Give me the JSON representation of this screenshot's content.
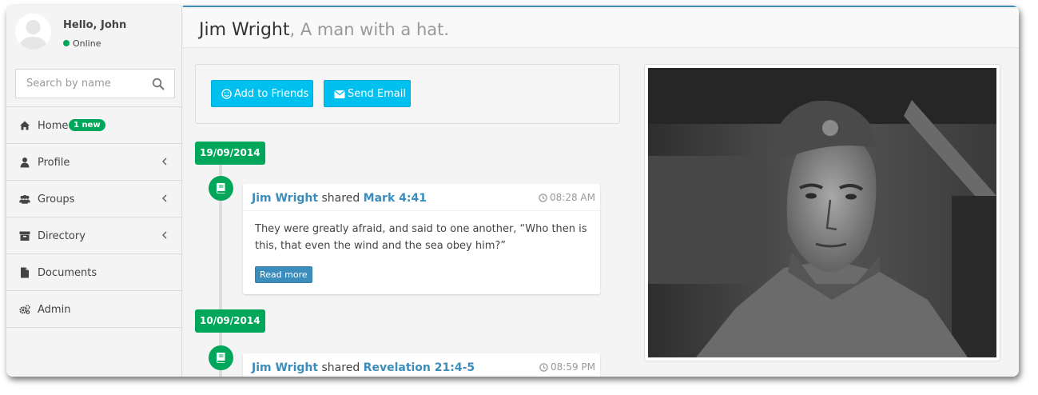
{
  "user": {
    "greeting": "Hello, John",
    "status": "Online",
    "status_color": "#00a65a"
  },
  "search": {
    "placeholder": "Search by name"
  },
  "menu": [
    {
      "label": "Home",
      "icon": "home-icon",
      "badge": "1 new"
    },
    {
      "label": "Profile",
      "icon": "user-icon",
      "has_submenu": true
    },
    {
      "label": "Groups",
      "icon": "users-icon",
      "has_submenu": true
    },
    {
      "label": "Directory",
      "icon": "archive-icon",
      "has_submenu": true
    },
    {
      "label": "Documents",
      "icon": "file-icon"
    },
    {
      "label": "Admin",
      "icon": "cogs-icon"
    }
  ],
  "profile": {
    "name": "Jim Wright",
    "subtitle": ", A man with a hat."
  },
  "actions": {
    "add_friends": "Add to Friends",
    "send_email": "Send Email"
  },
  "timeline": [
    {
      "date": "19/09/2014",
      "author": "Jim Wright",
      "verb": "shared",
      "reference": "Mark 4:41",
      "time": "08:28 AM",
      "body": "They were greatly afraid, and said to one another, “Who then is this, that even the wind and the sea obey him?”",
      "read_more": "Read more"
    },
    {
      "date": "10/09/2014",
      "author": "Jim Wright",
      "verb": "shared",
      "reference": "Revelation 21:4-5",
      "time": "08:59 PM"
    }
  ],
  "colors": {
    "accent": "#3c8dbc",
    "info": "#00c0ef",
    "success": "#00a65a"
  }
}
